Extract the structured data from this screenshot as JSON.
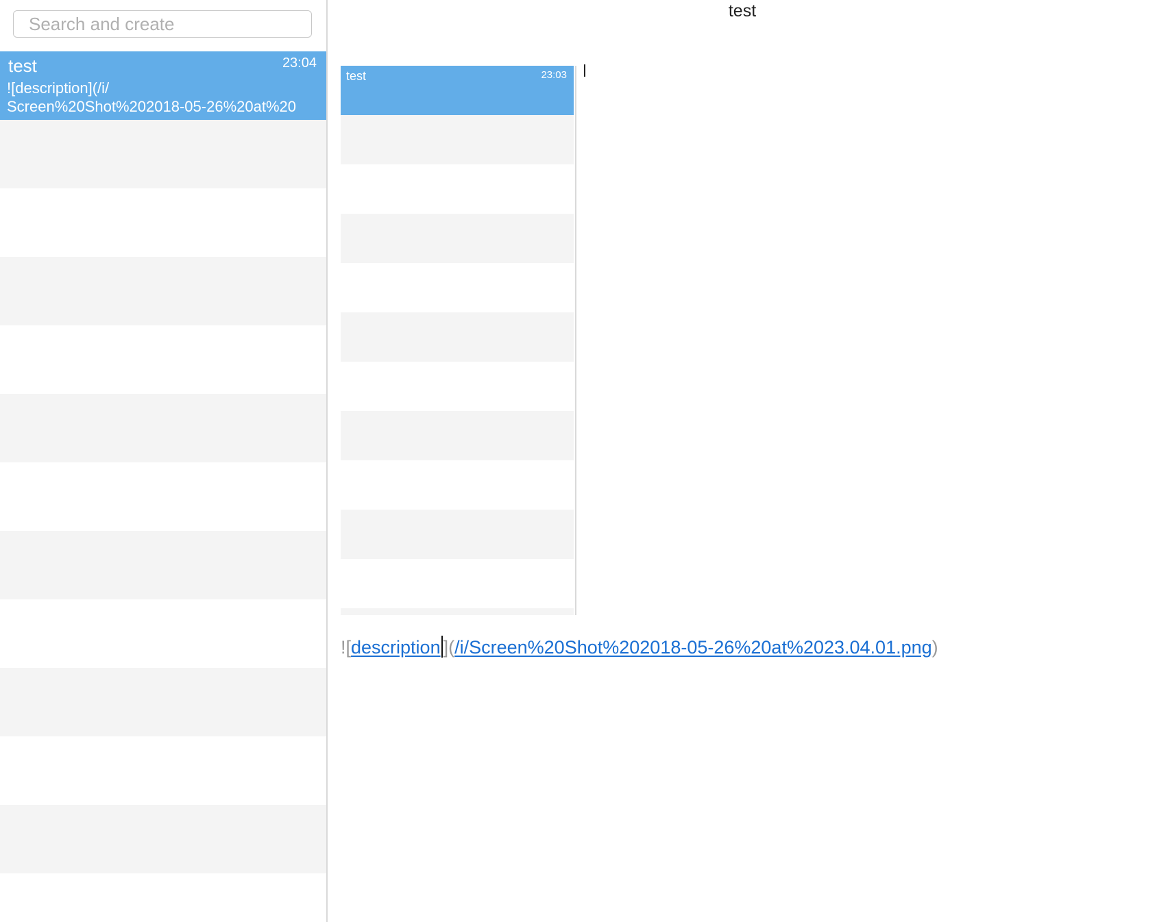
{
  "search": {
    "placeholder": "Search and create",
    "value": ""
  },
  "note_list": {
    "items": [
      {
        "title": "test",
        "time": "23:04",
        "preview": "![description](/i/\nScreen%20Shot%202018-05-26%20at%20",
        "selected": true
      }
    ]
  },
  "editor": {
    "title": "test",
    "embedded_image": {
      "title": "test",
      "time": "23:03"
    },
    "markdown": {
      "bang_bracket": "![",
      "description": "description",
      "close_bracket": "]",
      "open_paren": "(",
      "url": "/i/Screen%20Shot%202018-05-26%20at%2023.04.01.png",
      "close_paren": ")"
    }
  },
  "colors": {
    "selection": "#62ade8",
    "stripe": "#f4f4f4",
    "link": "#1a6fd3",
    "markup": "#9a9a9a"
  }
}
